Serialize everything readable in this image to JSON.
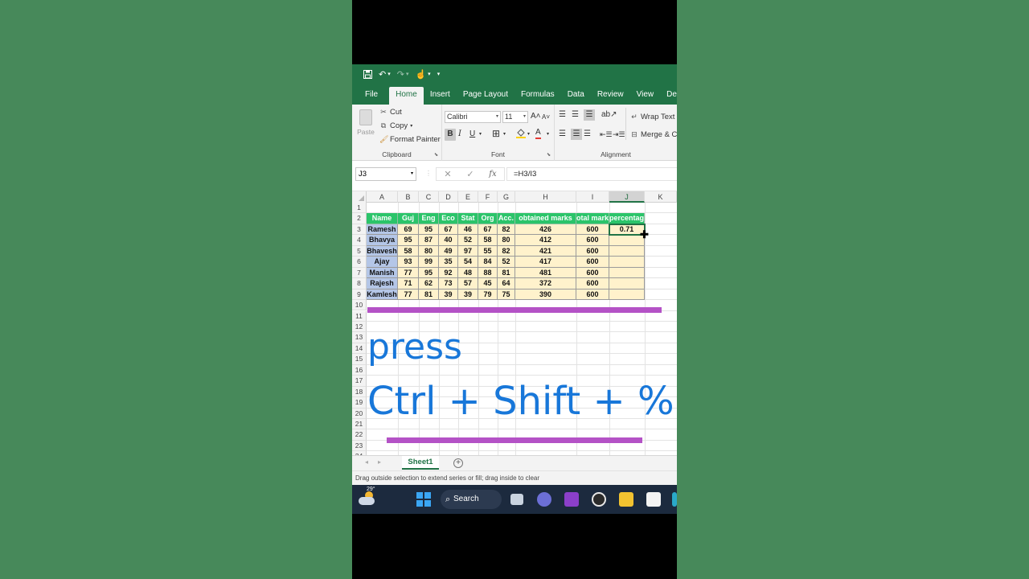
{
  "quick_access": {
    "icons": [
      "save-icon",
      "undo-icon",
      "redo-icon",
      "touch-mode-icon",
      "customize-qat-icon"
    ]
  },
  "tabs": [
    "File",
    "Home",
    "Insert",
    "Page Layout",
    "Formulas",
    "Data",
    "Review",
    "View",
    "Develope"
  ],
  "active_tab": "Home",
  "ribbon": {
    "clipboard": {
      "paste": "Paste",
      "cut": "Cut",
      "copy": "Copy",
      "format_painter": "Format Painter",
      "label": "Clipboard"
    },
    "font": {
      "name": "Calibri",
      "size": "11",
      "bold": "B",
      "italic": "I",
      "underline": "U",
      "grow": "A",
      "shrink": "A",
      "color": "A",
      "label": "Font"
    },
    "alignment": {
      "wrap_text": "Wrap Text",
      "merge": "Merge & C",
      "label": "Alignment"
    }
  },
  "formula_bar": {
    "name_box": "J3",
    "cancel": "✕",
    "enter": "✓",
    "fx": "fx",
    "formula": "=H3/I3"
  },
  "grid": {
    "columns": [
      "A",
      "B",
      "C",
      "D",
      "E",
      "F",
      "G",
      "H",
      "I",
      "J",
      "K"
    ],
    "selected_column": "J",
    "rows": [
      "1",
      "2",
      "3",
      "4",
      "5",
      "6",
      "7",
      "8",
      "9",
      "10",
      "11",
      "12",
      "13",
      "14",
      "15",
      "16",
      "17",
      "18",
      "19",
      "20",
      "21",
      "22",
      "23",
      "24"
    ],
    "headers": [
      "Name",
      "Guj",
      "Eng",
      "Eco",
      "Stat",
      "Org",
      "Acc.",
      "obtained marks",
      "otal mark",
      "percentage"
    ],
    "records": [
      [
        "Ramesh",
        "69",
        "95",
        "67",
        "46",
        "67",
        "82",
        "426",
        "600",
        "0.71"
      ],
      [
        "Bhavya",
        "95",
        "87",
        "40",
        "52",
        "58",
        "80",
        "412",
        "600",
        ""
      ],
      [
        "Bhavesh",
        "58",
        "80",
        "49",
        "97",
        "55",
        "82",
        "421",
        "600",
        ""
      ],
      [
        "Ajay",
        "93",
        "99",
        "35",
        "54",
        "84",
        "52",
        "417",
        "600",
        ""
      ],
      [
        "Manish",
        "77",
        "95",
        "92",
        "48",
        "88",
        "81",
        "481",
        "600",
        ""
      ],
      [
        "Rajesh",
        "71",
        "62",
        "73",
        "57",
        "45",
        "64",
        "372",
        "600",
        ""
      ],
      [
        "Kamlesh",
        "77",
        "81",
        "39",
        "39",
        "79",
        "75",
        "390",
        "600",
        ""
      ]
    ]
  },
  "overlay": {
    "line1": "press",
    "line2": "Ctrl + Shift + %",
    "text_color": "#1877d9",
    "bar_color": "#b452c6"
  },
  "sheets": {
    "active": "Sheet1",
    "add": "+"
  },
  "status_bar": "Drag outside selection to extend series or fill; drag inside to clear",
  "taskbar": {
    "temperature": "29°",
    "search": "Search",
    "icons": [
      "weather-icon",
      "windows-start-icon",
      "search-icon",
      "task-view-icon",
      "chat-icon",
      "clipchamp-icon",
      "media-player-icon",
      "file-explorer-icon",
      "microsoft-store-icon"
    ]
  },
  "colors": {
    "excel_green": "#217346",
    "header_green": "#2bc46a",
    "name_blue": "#b4c6e7",
    "marks_yellow": "#fff2cc",
    "background_green": "#47895a"
  }
}
